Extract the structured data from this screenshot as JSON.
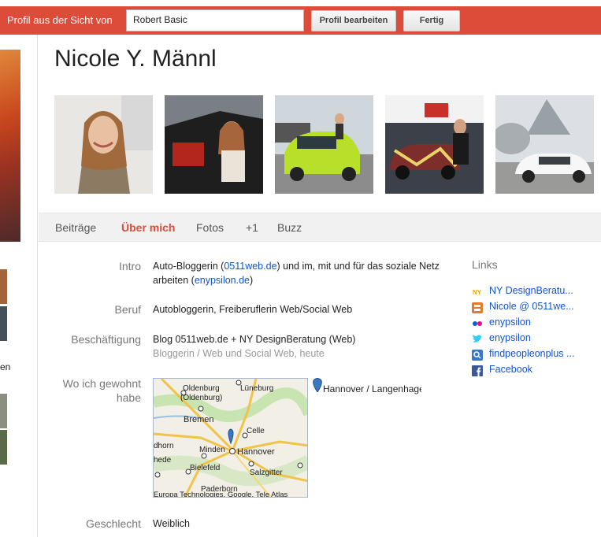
{
  "topbar": {
    "label": "Profil aus der Sicht von",
    "viewer_value": "Robert Basic",
    "edit_button": "Profil bearbeiten",
    "done_button": "Fertig"
  },
  "sidebar": {
    "fragment_text": "en"
  },
  "profile": {
    "name": "Nicole Y. Männl"
  },
  "tabs": [
    "Beiträge",
    "Über mich",
    "Fotos",
    "+1",
    "Buzz"
  ],
  "about": {
    "intro_label": "Intro",
    "intro_text_1": "Auto-Bloggerin (",
    "intro_link_1": "0511web.de",
    "intro_text_2": ") und im, mit und für das soziale Netz",
    "intro_text_3": "arbeiten (",
    "intro_link_2": "enypsilon.de",
    "intro_text_4": ")",
    "job_label": "Beruf",
    "job_value": "Autobloggerin, Freiberuflerin Web/Social Web",
    "employment_label": "Beschäftigung",
    "employment_value": "Blog 0511web.de + NY DesignBeratung (Web)",
    "employment_sub": "Bloggerin / Web und Social Web, heute",
    "places_label_1": "Wo ich gewohnt",
    "places_label_2": "habe",
    "place_value": "Hannover / Langenhagen",
    "gender_label": "Geschlecht",
    "gender_value": "Weiblich"
  },
  "map": {
    "labels": [
      "Oldenburg",
      "(Oldenburg)",
      "Lüneburg",
      "Bremen",
      "Celle",
      "Hannover",
      "Minden",
      "Bielefeld",
      "Salzgitter",
      "dhorn",
      "hede",
      "Paderborn"
    ],
    "attribution": "Europa Technologies, Google, Tele Atlas"
  },
  "links": {
    "title": "Links",
    "items": [
      {
        "label": "NY DesignBeratu...",
        "icon": "ny-site-icon",
        "color": "#e8a400"
      },
      {
        "label": "Nicole @ 0511we...",
        "icon": "blogger-icon",
        "color": "#e27b2b"
      },
      {
        "label": "enypsilon",
        "icon": "flickr-icon",
        "color": "#ff0084"
      },
      {
        "label": "enypsilon",
        "icon": "twitter-icon",
        "color": "#33ccff"
      },
      {
        "label": "findpeopleonplus ...",
        "icon": "search-site-icon",
        "color": "#3b78c3"
      },
      {
        "label": "Facebook",
        "icon": "facebook-icon",
        "color": "#3b5998"
      }
    ]
  },
  "colors": {
    "accent": "#dd4b39",
    "link": "#1155cc"
  }
}
